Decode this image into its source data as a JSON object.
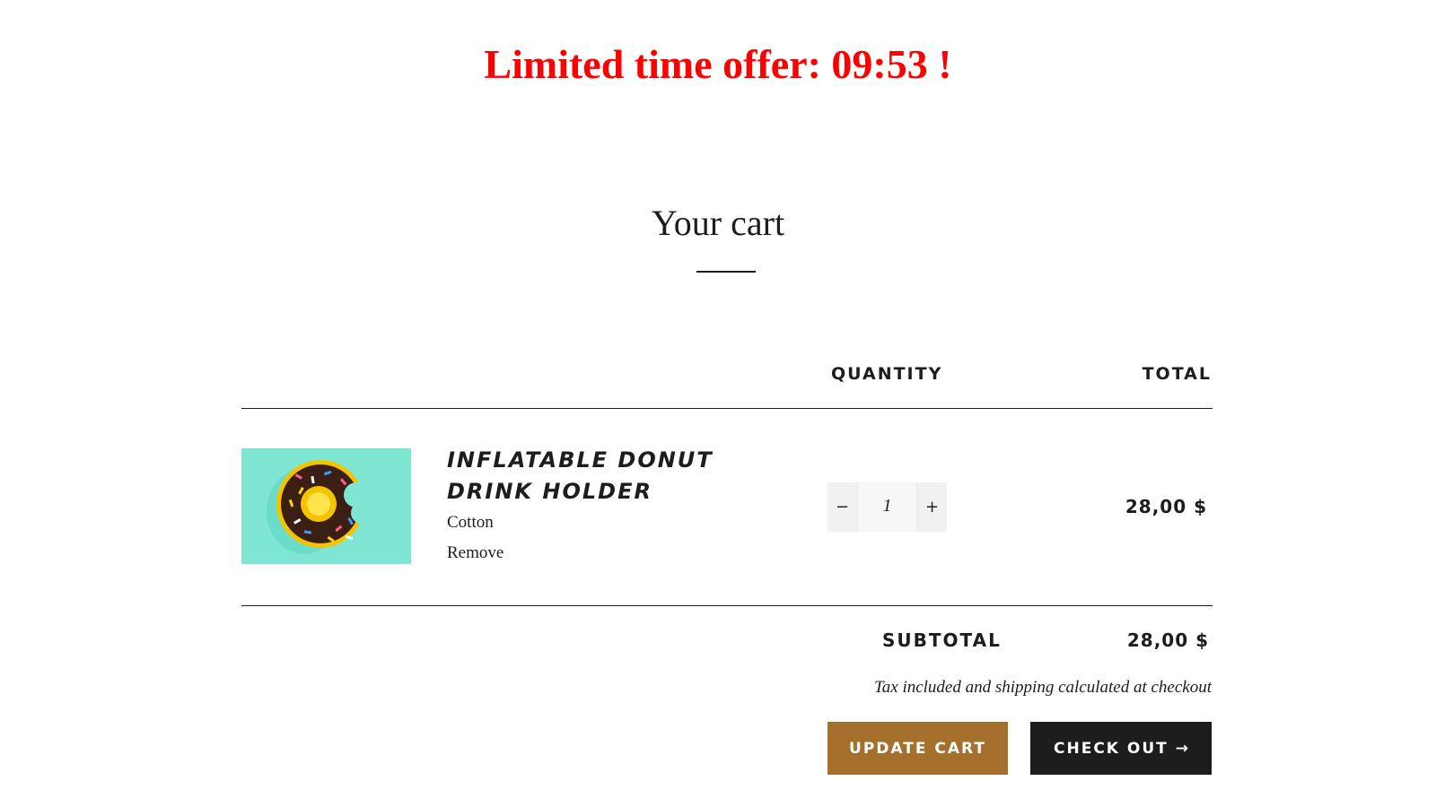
{
  "banner": {
    "offer_text": "Limited time offer: 09:53 !",
    "color": "#ff0000"
  },
  "cart": {
    "title": "Your cart",
    "columns": {
      "quantity": "QUANTITY",
      "total": "TOTAL"
    },
    "items": [
      {
        "name": "INFLATABLE DONUT DRINK HOLDER",
        "variant": "Cotton",
        "remove_label": "Remove",
        "quantity": "1",
        "decrease_symbol": "−",
        "increase_symbol": "+",
        "line_total": "28,00 $",
        "image_icon": "donut-image"
      }
    ],
    "subtotal_label": "SUBTOTAL",
    "subtotal_value": "28,00 $",
    "tax_note": "Tax included and shipping calculated at checkout",
    "update_button": "UPDATE CART",
    "checkout_button": "CHECK OUT",
    "checkout_arrow": "→"
  },
  "colors": {
    "accent": "#a5702b",
    "dark": "#1c1d1d",
    "image_background": "#7fe6d4"
  }
}
